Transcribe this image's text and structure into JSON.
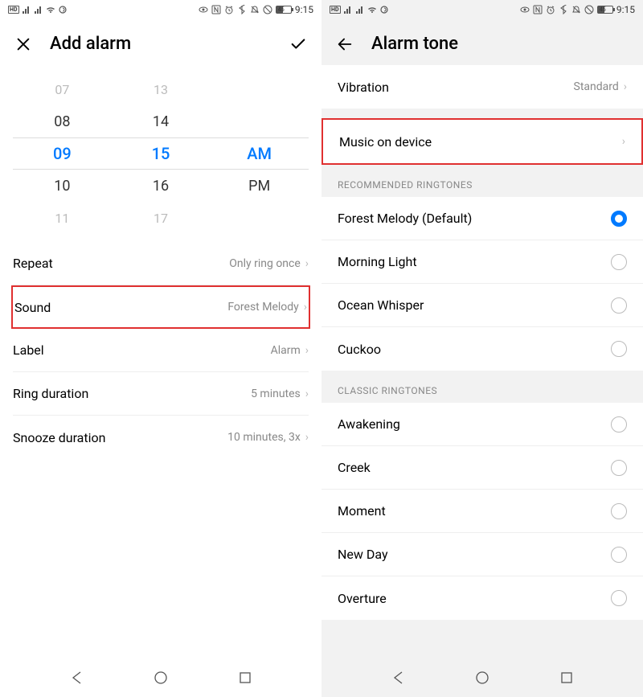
{
  "status": {
    "time": "9:15",
    "battery_pct": "45",
    "hd_badge": "HD"
  },
  "left": {
    "title": "Add alarm",
    "picker": {
      "hours": [
        "07",
        "08",
        "09",
        "10",
        "11"
      ],
      "minutes": [
        "13",
        "14",
        "15",
        "16",
        "17"
      ],
      "ampm": [
        "AM",
        "PM"
      ],
      "selected_hour_idx": 2,
      "selected_minute_idx": 2,
      "selected_ampm_idx": 0
    },
    "settings": [
      {
        "label": "Repeat",
        "value": "Only ring once",
        "highlight": false
      },
      {
        "label": "Sound",
        "value": "Forest Melody",
        "highlight": true
      },
      {
        "label": "Label",
        "value": "Alarm",
        "highlight": false
      },
      {
        "label": "Ring duration",
        "value": "5 minutes",
        "highlight": false
      },
      {
        "label": "Snooze duration",
        "value": "10 minutes, 3x",
        "highlight": false
      }
    ]
  },
  "right": {
    "title": "Alarm tone",
    "vibration": {
      "label": "Vibration",
      "value": "Standard"
    },
    "music": {
      "label": "Music on device"
    },
    "section1_title": "RECOMMENDED RINGTONES",
    "section1": [
      {
        "label": "Forest Melody (Default)",
        "selected": true
      },
      {
        "label": "Morning Light",
        "selected": false
      },
      {
        "label": "Ocean Whisper",
        "selected": false
      },
      {
        "label": "Cuckoo",
        "selected": false
      }
    ],
    "section2_title": "CLASSIC RINGTONES",
    "section2": [
      {
        "label": "Awakening",
        "selected": false
      },
      {
        "label": "Creek",
        "selected": false
      },
      {
        "label": "Moment",
        "selected": false
      },
      {
        "label": "New Day",
        "selected": false
      },
      {
        "label": "Overture",
        "selected": false
      }
    ]
  }
}
